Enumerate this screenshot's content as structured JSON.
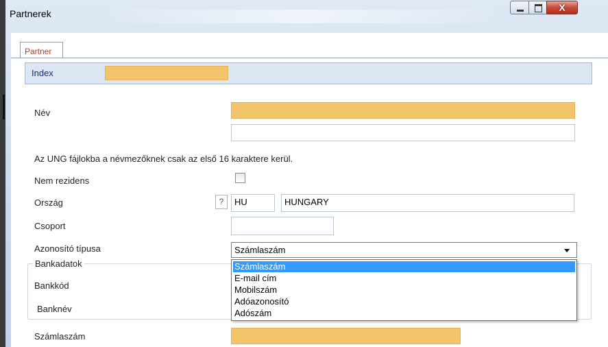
{
  "window": {
    "title": "Partnerek",
    "close_glyph": "X"
  },
  "tabs": [
    {
      "label": "Partner",
      "active": true
    }
  ],
  "form": {
    "index_label": "Index",
    "index_value": "",
    "nev_label": "Név",
    "nev_value": "",
    "nev2_value": "",
    "note": "Az UNG fájlokba a névmezőknek csak az első 16 karaktere kerül.",
    "nem_rezidens_label": "Nem rezidens",
    "nem_rezidens_checked": false,
    "orszag_label": "Ország",
    "orszag_help": "?",
    "orszag_code": "HU",
    "orszag_name": "HUNGARY",
    "csoport_label": "Csoport",
    "csoport_value": "",
    "azonosito_label": "Azonosító típusa",
    "azonosito_selected": "Számlaszám",
    "azonosito_options": [
      "Számlaszám",
      "E-mail cím",
      "Mobilszám",
      "Adóazonosító",
      "Adószám"
    ],
    "bankadatok_title": "Bankadatok",
    "bankkod_label": "Bankkód",
    "banknev_label": "Banknév",
    "szamlaszam_label": "Számlaszám",
    "szamlaszam_value": ""
  },
  "colors": {
    "required_field": "#f3c46a",
    "selection": "#3399ff",
    "tab_text": "#c0392b"
  }
}
